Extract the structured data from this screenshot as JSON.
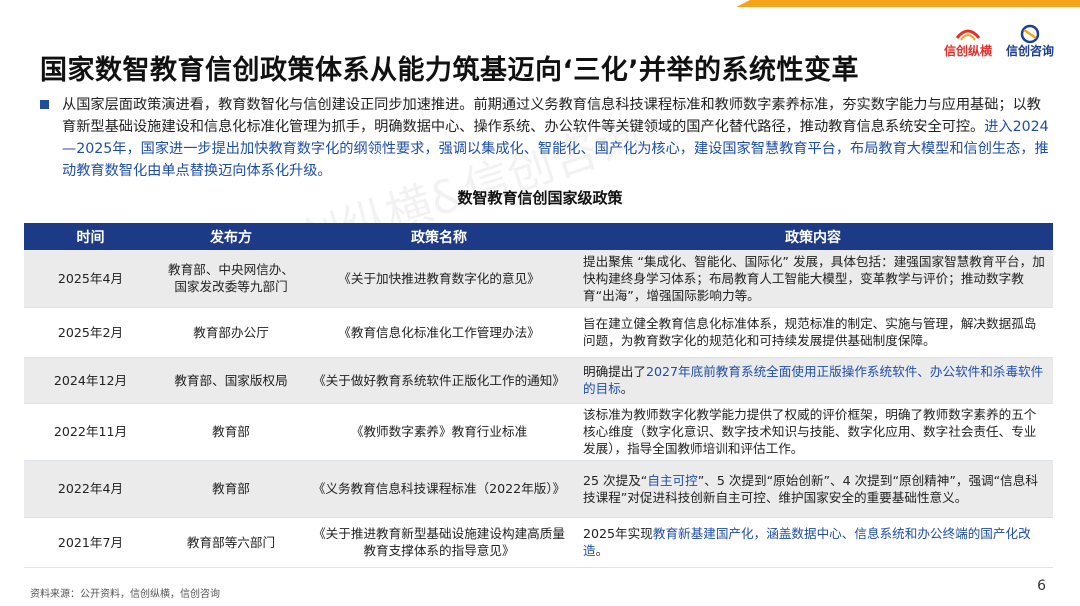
{
  "slide": {
    "title": "国家数智教育信创政策体系从能力筑基迈向‘三化’并举的系统性变革",
    "accent_color": "#f5a31a",
    "header_color": "#1d3a86",
    "highlight_color": "#1f4ea8"
  },
  "logos": [
    {
      "text": "信创纵横",
      "icon": "xinchuang-zongheng-logo-icon"
    },
    {
      "text": "信创咨询",
      "icon": "xinchuang-consulting-logo-icon"
    }
  ],
  "intro": {
    "plain": "从国家层面政策演进看，教育数智化与信创建设正同步加速推进。前期通过义务教育信息科技课程标准和教师数字素养标准，夯实数字能力与应用基础；以教育新型基础设施建设和信息化标准化管理为抓手，明确数据中心、操作系统、办公软件等关键领域的国产化替代路径，推动教育信息系统安全可控。",
    "highlight": "进入2024—2025年，国家进一步提出加快教育数字化的纲领性要求，强调以集成化、智能化、国产化为核心，建设国家智慧教育平台，布局教育大模型和信创生态，推动教育数智化由单点替换迈向体系化升级。"
  },
  "watermark": "信创纵横&信创咨询",
  "table": {
    "title": "数智教育信创国家级政策",
    "headers": [
      "时间",
      "发布方",
      "政策名称",
      "政策内容"
    ],
    "rows": [
      {
        "time": "2025年4月",
        "issuer": "教育部、中央网信办、国家发改委等九部门",
        "name": "《关于加快推进教育数字化的意见》",
        "content_pre": "提出聚焦 “集成化、智能化、国际化” 发展，具体包括：建强国家智慧教育平台，加快构建终身学习体系；布局教育人工智能大模型，变革教学与评价；推动数字教育“出海”，增强国际影响力等。",
        "content_hl": "",
        "content_post": ""
      },
      {
        "time": "2025年2月",
        "issuer": "教育部办公厅",
        "name": "《教育信息化标准化工作管理办法》",
        "content_pre": "旨在建立健全教育信息化标准体系，规范标准的制定、实施与管理，解决数据孤岛问题，为教育数字化的规范化和可持续发展提供基础制度保障。",
        "content_hl": "",
        "content_post": ""
      },
      {
        "time": "2024年12月",
        "issuer": "教育部、国家版权局",
        "name": "《关于做好教育系统软件正版化工作的通知》",
        "content_pre": "明确提出了",
        "content_hl": "2027年底前教育系统全面使用正版操作系统软件、办公软件和杀毒软件的目标",
        "content_post": "。"
      },
      {
        "time": "2022年11月",
        "issuer": "教育部",
        "name": "《教师数字素养》教育行业标准",
        "content_pre": "该标准为教师数字化教学能力提供了权威的评价框架，明确了教师数字素养的五个核心维度（数字化意识、数字技术知识与技能、数字化应用、数字社会责任、专业发展），指导全国教师培训和评估工作。",
        "content_hl": "",
        "content_post": ""
      },
      {
        "time": "2022年4月",
        "issuer": "教育部",
        "name": "《义务教育信息科技课程标准（2022年版）》",
        "content_pre": "25 次提及“",
        "content_hl": "自主可控",
        "content_post": "”、5 次提到“原始创新”、4 次提到“原创精神”，强调“信息科技课程”对促进科技创新自主可控、维护国家安全的重要基础性意义。"
      },
      {
        "time": "2021年7月",
        "issuer": "教育部等六部门",
        "name": "《关于推进教育新型基础设施建设构建高质量教育支撑体系的指导意见》",
        "content_pre": "2025年实现",
        "content_hl": "教育新基建国产化，涵盖数据中心、信息系统和办公终端的国产化改造",
        "content_post": "。"
      }
    ]
  },
  "footer": {
    "source": "资料来源：公开资料，信创纵横，信创咨询",
    "page_number": "6"
  }
}
